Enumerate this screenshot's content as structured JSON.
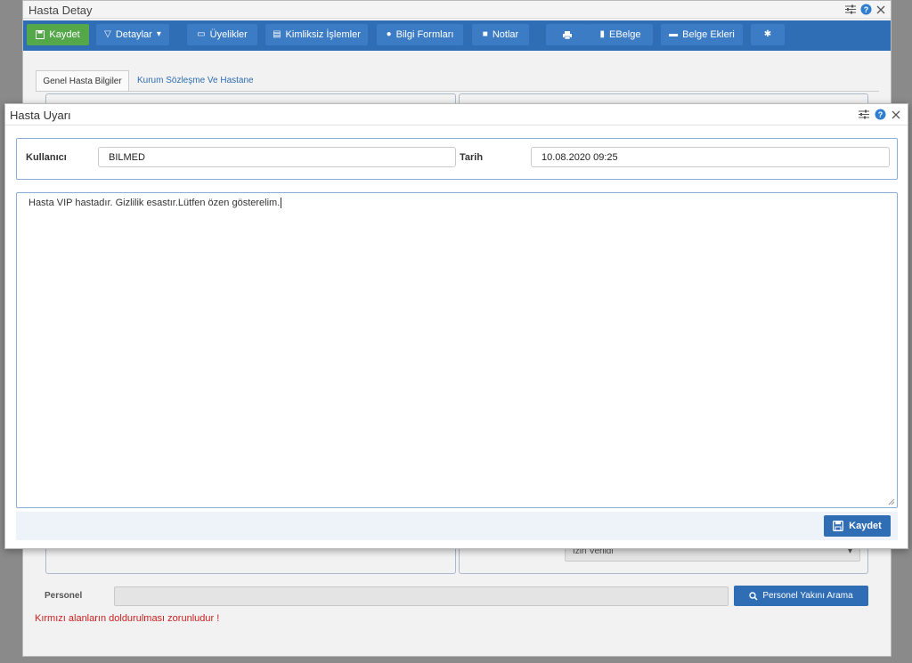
{
  "background_window": {
    "title": "Hasta Detay",
    "toolbar": [
      {
        "label": "Kaydet",
        "icon": "save-icon"
      },
      {
        "label": "Detaylar",
        "icon": "filter-icon"
      },
      {
        "label": "Üyelikler",
        "icon": "monitor-icon"
      },
      {
        "label": "Kimliksiz İşlemler",
        "icon": "id-card-icon"
      },
      {
        "label": "Bilgi Formları",
        "icon": "users-icon"
      },
      {
        "label": "Notlar",
        "icon": "note-icon"
      },
      {
        "label": "",
        "icon": "print-icon"
      },
      {
        "label": "EBelge",
        "icon": "book-icon"
      },
      {
        "label": "Belge Ekleri",
        "icon": "folder-icon"
      },
      {
        "label": "",
        "icon": "gear-icon"
      }
    ],
    "tabs": {
      "active": "Genel Hasta Bilgiler",
      "other": "Kurum Sözleşme Ve Hastane"
    },
    "partial_select_value": "İzin Verildi",
    "personel_label": "Personel",
    "personel_search_button": "Personel Yakını Arama",
    "required_note": "Kırmızı alanların doldurulması zorunludur !"
  },
  "modal": {
    "title": "Hasta Uyarı",
    "user_label": "Kullanıcı",
    "user_value": "BILMED",
    "date_label": "Tarih",
    "date_value": "10.08.2020 09:25",
    "message": "Hasta VIP hastadır. Gizlilik esastır.Lütfen özen gösterelim.",
    "save_label": "Kaydet"
  },
  "colors": {
    "toolbar": "#2f6db5",
    "save_green": "#55a84a",
    "border_blue": "#8aaed6",
    "required_red": "#cc1f1f"
  }
}
